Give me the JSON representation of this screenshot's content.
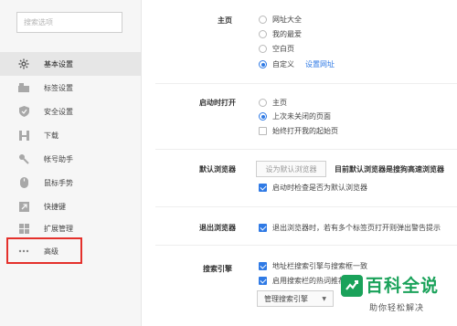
{
  "sidebar": {
    "search_placeholder": "搜索选项",
    "items": [
      {
        "label": "基本设置",
        "icon": "gear-icon",
        "active": true
      },
      {
        "label": "标签设置",
        "icon": "tab-icon"
      },
      {
        "label": "安全设置",
        "icon": "shield-icon"
      },
      {
        "label": "下载",
        "icon": "download-icon"
      },
      {
        "label": "帐号助手",
        "icon": "key-icon"
      },
      {
        "label": "鼠标手势",
        "icon": "mouse-icon"
      },
      {
        "label": "快捷键",
        "icon": "shortcut-icon"
      },
      {
        "label": "扩展管理",
        "icon": "extensions-icon"
      },
      {
        "label": "高级",
        "icon": "more-icon"
      }
    ]
  },
  "homepage": {
    "title": "主页",
    "options": [
      "网址大全",
      "我的最爱",
      "空白页",
      "自定义"
    ],
    "selected": "自定义",
    "set_url_link": "设置网址"
  },
  "startup": {
    "title": "启动时打开",
    "options": [
      "主页",
      "上次未关闭的页面"
    ],
    "selected": "上次未关闭的页面",
    "always_open_start_page": "始终打开我的起始页",
    "always_open_checked": false
  },
  "default_browser": {
    "title": "默认浏览器",
    "button": "设为默认浏览器",
    "status": "目前默认浏览器是搜狗高速浏览器",
    "check_on_startup": "启动时检查是否为默认浏览器",
    "check_on_startup_checked": true
  },
  "exit_browser": {
    "title": "退出浏览器",
    "warn_multi_tabs": "退出浏览器时，若有多个标签页打开则弹出警告提示",
    "warn_checked": true
  },
  "search_engine": {
    "title": "搜索引擎",
    "sync_address_bar": "地址栏搜索引擎与搜索框一致",
    "sync_checked": true,
    "hot_words": "启用搜索栏的热词推荐",
    "hot_words_checked": true,
    "manage_button": "管理搜索引擎",
    "manage_arrow": "▼"
  },
  "watermark": {
    "title": "百科全说",
    "subtitle": "助你轻松解决",
    "color": "#1aa25a"
  },
  "colors": {
    "accent": "#2f7ae5",
    "highlight": "#e4302b"
  }
}
